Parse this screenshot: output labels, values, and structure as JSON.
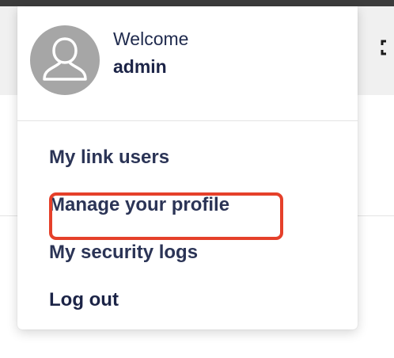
{
  "user": {
    "greeting": "Welcome",
    "username": "admin"
  },
  "menu": {
    "items": [
      {
        "label": "My link users"
      },
      {
        "label": "Manage your profile"
      },
      {
        "label": "My security logs"
      },
      {
        "label": "Log out"
      }
    ]
  },
  "colors": {
    "text_primary": "#1c2447",
    "highlight": "#e5402a",
    "avatar_bg": "#a6a6a6"
  },
  "icons": {
    "avatar": "user-silhouette-icon",
    "fullscreen": "fullscreen-icon"
  }
}
